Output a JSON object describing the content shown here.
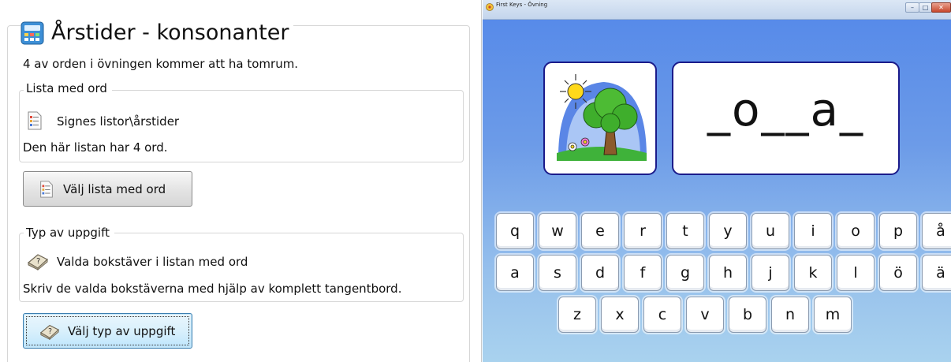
{
  "settings": {
    "title": "Årstider - konsonanter",
    "gap_info": "4 av orden i övningen kommer att ha tomrum.",
    "word_list": {
      "legend": "Lista med ord",
      "name": "Signes listor\\årstider",
      "count_text": "Den här listan har 4 ord.",
      "choose_button": "Välj lista med ord"
    },
    "task": {
      "legend": "Typ av uppgift",
      "name": "Valda bokstäver i listan med ord",
      "description": "Skriv de valda bokstäverna med hjälp av komplett tangentbord.",
      "choose_button": "Välj typ av uppgift"
    }
  },
  "app_window": {
    "title": "First Keys - Övning",
    "controls": {
      "minimize": "–",
      "maximize": "□",
      "close": "✕"
    },
    "word_display": "_o__a_",
    "picture_icon": "sun-tree-flowers-picture"
  },
  "keyboard": {
    "row1": [
      "q",
      "w",
      "e",
      "r",
      "t",
      "y",
      "u",
      "i",
      "o",
      "p",
      "å"
    ],
    "row2": [
      "a",
      "s",
      "d",
      "f",
      "g",
      "h",
      "j",
      "k",
      "l",
      "ö",
      "ä"
    ],
    "row3": [
      "z",
      "x",
      "c",
      "v",
      "b",
      "n",
      "m"
    ]
  },
  "colors": {
    "card_border": "#1b1b8a",
    "window_background_top": "#5488e9",
    "window_background_bottom": "#a9d2ee",
    "focused_button_border": "#3c7fb1"
  }
}
